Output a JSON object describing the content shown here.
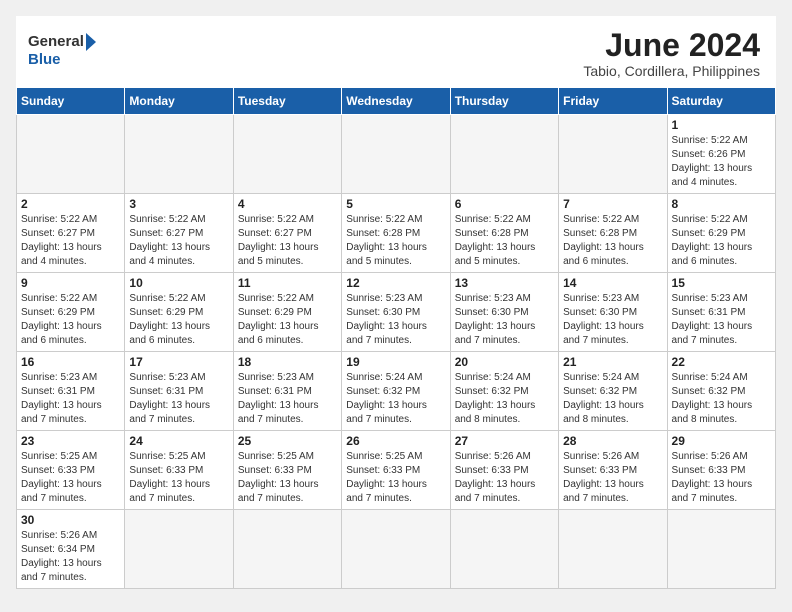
{
  "logo": {
    "general": "General",
    "blue": "Blue"
  },
  "header": {
    "title": "June 2024",
    "subtitle": "Tabio, Cordillera, Philippines"
  },
  "weekdays": [
    "Sunday",
    "Monday",
    "Tuesday",
    "Wednesday",
    "Thursday",
    "Friday",
    "Saturday"
  ],
  "weeks": [
    [
      {
        "day": "",
        "info": ""
      },
      {
        "day": "",
        "info": ""
      },
      {
        "day": "",
        "info": ""
      },
      {
        "day": "",
        "info": ""
      },
      {
        "day": "",
        "info": ""
      },
      {
        "day": "",
        "info": ""
      },
      {
        "day": "1",
        "info": "Sunrise: 5:22 AM\nSunset: 6:26 PM\nDaylight: 13 hours and 4 minutes."
      }
    ],
    [
      {
        "day": "2",
        "info": "Sunrise: 5:22 AM\nSunset: 6:27 PM\nDaylight: 13 hours and 4 minutes."
      },
      {
        "day": "3",
        "info": "Sunrise: 5:22 AM\nSunset: 6:27 PM\nDaylight: 13 hours and 4 minutes."
      },
      {
        "day": "4",
        "info": "Sunrise: 5:22 AM\nSunset: 6:27 PM\nDaylight: 13 hours and 5 minutes."
      },
      {
        "day": "5",
        "info": "Sunrise: 5:22 AM\nSunset: 6:28 PM\nDaylight: 13 hours and 5 minutes."
      },
      {
        "day": "6",
        "info": "Sunrise: 5:22 AM\nSunset: 6:28 PM\nDaylight: 13 hours and 5 minutes."
      },
      {
        "day": "7",
        "info": "Sunrise: 5:22 AM\nSunset: 6:28 PM\nDaylight: 13 hours and 6 minutes."
      },
      {
        "day": "8",
        "info": "Sunrise: 5:22 AM\nSunset: 6:29 PM\nDaylight: 13 hours and 6 minutes."
      }
    ],
    [
      {
        "day": "9",
        "info": "Sunrise: 5:22 AM\nSunset: 6:29 PM\nDaylight: 13 hours and 6 minutes."
      },
      {
        "day": "10",
        "info": "Sunrise: 5:22 AM\nSunset: 6:29 PM\nDaylight: 13 hours and 6 minutes."
      },
      {
        "day": "11",
        "info": "Sunrise: 5:22 AM\nSunset: 6:29 PM\nDaylight: 13 hours and 6 minutes."
      },
      {
        "day": "12",
        "info": "Sunrise: 5:23 AM\nSunset: 6:30 PM\nDaylight: 13 hours and 7 minutes."
      },
      {
        "day": "13",
        "info": "Sunrise: 5:23 AM\nSunset: 6:30 PM\nDaylight: 13 hours and 7 minutes."
      },
      {
        "day": "14",
        "info": "Sunrise: 5:23 AM\nSunset: 6:30 PM\nDaylight: 13 hours and 7 minutes."
      },
      {
        "day": "15",
        "info": "Sunrise: 5:23 AM\nSunset: 6:31 PM\nDaylight: 13 hours and 7 minutes."
      }
    ],
    [
      {
        "day": "16",
        "info": "Sunrise: 5:23 AM\nSunset: 6:31 PM\nDaylight: 13 hours and 7 minutes."
      },
      {
        "day": "17",
        "info": "Sunrise: 5:23 AM\nSunset: 6:31 PM\nDaylight: 13 hours and 7 minutes."
      },
      {
        "day": "18",
        "info": "Sunrise: 5:23 AM\nSunset: 6:31 PM\nDaylight: 13 hours and 7 minutes."
      },
      {
        "day": "19",
        "info": "Sunrise: 5:24 AM\nSunset: 6:32 PM\nDaylight: 13 hours and 7 minutes."
      },
      {
        "day": "20",
        "info": "Sunrise: 5:24 AM\nSunset: 6:32 PM\nDaylight: 13 hours and 8 minutes."
      },
      {
        "day": "21",
        "info": "Sunrise: 5:24 AM\nSunset: 6:32 PM\nDaylight: 13 hours and 8 minutes."
      },
      {
        "day": "22",
        "info": "Sunrise: 5:24 AM\nSunset: 6:32 PM\nDaylight: 13 hours and 8 minutes."
      }
    ],
    [
      {
        "day": "23",
        "info": "Sunrise: 5:25 AM\nSunset: 6:33 PM\nDaylight: 13 hours and 7 minutes."
      },
      {
        "day": "24",
        "info": "Sunrise: 5:25 AM\nSunset: 6:33 PM\nDaylight: 13 hours and 7 minutes."
      },
      {
        "day": "25",
        "info": "Sunrise: 5:25 AM\nSunset: 6:33 PM\nDaylight: 13 hours and 7 minutes."
      },
      {
        "day": "26",
        "info": "Sunrise: 5:25 AM\nSunset: 6:33 PM\nDaylight: 13 hours and 7 minutes."
      },
      {
        "day": "27",
        "info": "Sunrise: 5:26 AM\nSunset: 6:33 PM\nDaylight: 13 hours and 7 minutes."
      },
      {
        "day": "28",
        "info": "Sunrise: 5:26 AM\nSunset: 6:33 PM\nDaylight: 13 hours and 7 minutes."
      },
      {
        "day": "29",
        "info": "Sunrise: 5:26 AM\nSunset: 6:33 PM\nDaylight: 13 hours and 7 minutes."
      }
    ],
    [
      {
        "day": "30",
        "info": "Sunrise: 5:26 AM\nSunset: 6:34 PM\nDaylight: 13 hours and 7 minutes."
      },
      {
        "day": "",
        "info": ""
      },
      {
        "day": "",
        "info": ""
      },
      {
        "day": "",
        "info": ""
      },
      {
        "day": "",
        "info": ""
      },
      {
        "day": "",
        "info": ""
      },
      {
        "day": "",
        "info": ""
      }
    ]
  ]
}
